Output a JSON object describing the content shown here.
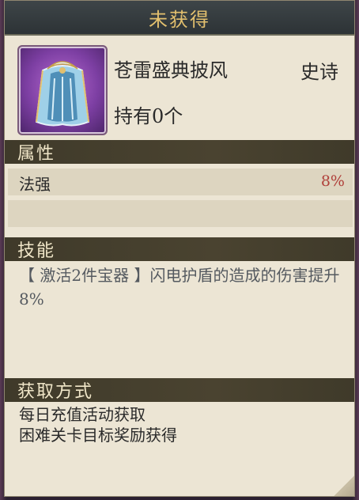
{
  "header": {
    "title": "未获得"
  },
  "item": {
    "icon": "cape-icon",
    "name": "苍雷盛典披风",
    "rarity": "史诗",
    "owned": "持有0个"
  },
  "sections": {
    "attributes_title": "属性",
    "skill_title": "技能",
    "source_title": "获取方式"
  },
  "attributes": [
    {
      "label": "法强",
      "value": "8%"
    }
  ],
  "skill": {
    "text": "【 激活2件宝器 】闪电护盾的造成的伤害提升8%"
  },
  "source": {
    "line1": "每日充值活动获取",
    "line2": "困难关卡目标奖励获得"
  },
  "colors": {
    "title_gold": "#e3c06e",
    "value_red": "#b0403a",
    "panel_bg": "#ece5d4"
  }
}
